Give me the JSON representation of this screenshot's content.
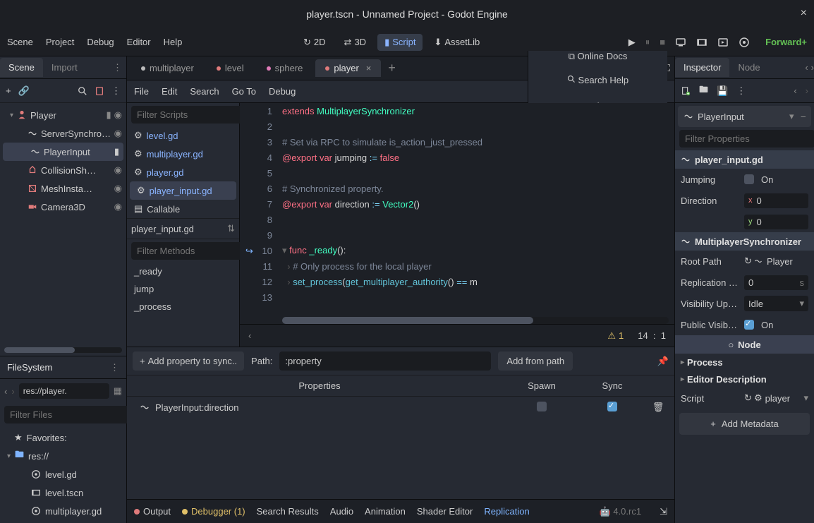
{
  "window": {
    "title": "player.tscn - Unnamed Project - Godot Engine"
  },
  "main_menu": [
    "Scene",
    "Project",
    "Debug",
    "Editor",
    "Help"
  ],
  "workspace_modes": [
    {
      "label": "2D",
      "active": false
    },
    {
      "label": "3D",
      "active": false
    },
    {
      "label": "Script",
      "active": true
    },
    {
      "label": "AssetLib",
      "active": false
    }
  ],
  "renderer": "Forward+",
  "left_tabs": {
    "scene": "Scene",
    "import": "Import"
  },
  "scene_tree": [
    {
      "name": "Player",
      "indent": 0,
      "selected": false,
      "icon": "player",
      "tail": [
        "script",
        "eye"
      ]
    },
    {
      "name": "ServerSynchroniz…",
      "indent": 1,
      "selected": false,
      "icon": "sync",
      "tail": [
        "eye"
      ]
    },
    {
      "name": "PlayerInput",
      "indent": 1,
      "selected": true,
      "icon": "sync",
      "tail": [
        "script"
      ]
    },
    {
      "name": "CollisionSh…",
      "indent": 1,
      "selected": false,
      "icon": "collision",
      "tail": [
        "eye"
      ]
    },
    {
      "name": "MeshInsta…",
      "indent": 1,
      "selected": false,
      "icon": "mesh",
      "tail": [
        "eye"
      ]
    },
    {
      "name": "Camera3D",
      "indent": 1,
      "selected": false,
      "icon": "camera",
      "tail": [
        "eye"
      ]
    }
  ],
  "filesystem": {
    "title": "FileSystem",
    "path": "res://player.",
    "filter_placeholder": "Filter Files",
    "items": [
      {
        "label": "Favorites:",
        "icon": "star",
        "indent": 0,
        "caret": false
      },
      {
        "label": "res://",
        "icon": "folder",
        "indent": 0,
        "caret": true
      },
      {
        "label": "level.gd",
        "icon": "gd",
        "indent": 1,
        "caret": false
      },
      {
        "label": "level.tscn",
        "icon": "scene",
        "indent": 1,
        "caret": false
      },
      {
        "label": "multiplayer.gd",
        "icon": "gd",
        "indent": 1,
        "caret": false
      }
    ]
  },
  "script_tabs": [
    {
      "label": "multiplayer",
      "active": false,
      "color": "#bbbbbb",
      "closable": false
    },
    {
      "label": "level",
      "active": false,
      "color": "#e07b7b",
      "closable": false
    },
    {
      "label": "sphere",
      "active": false,
      "color": "#e07bb8",
      "closable": false
    },
    {
      "label": "player",
      "active": true,
      "color": "#e07b7b",
      "closable": true
    }
  ],
  "script_menu": [
    "File",
    "Edit",
    "Search",
    "Go To",
    "Debug"
  ],
  "script_menu_right": {
    "online": "Online Docs",
    "search": "Search Help"
  },
  "script_filter_placeholder": "Filter Scripts",
  "script_list": [
    {
      "label": "level.gd",
      "selected": false
    },
    {
      "label": "multiplayer.gd",
      "selected": false
    },
    {
      "label": "player.gd",
      "selected": false
    },
    {
      "label": "player_input.gd",
      "selected": true
    },
    {
      "label": "Callable",
      "selected": false,
      "doc": true
    }
  ],
  "current_script": "player_input.gd",
  "method_filter_placeholder": "Filter Methods",
  "methods": [
    "_ready",
    "jump",
    "_process"
  ],
  "code_status": {
    "warnings": "1",
    "line": "14",
    "col": "1"
  },
  "replication": {
    "add_btn": "Add property to sync..",
    "path_label": "Path:",
    "path_value": ":property",
    "add_path": "Add from path",
    "headers": {
      "prop": "Properties",
      "spawn": "Spawn",
      "sync": "Sync"
    },
    "rows": [
      {
        "prop": "PlayerInput:direction",
        "spawn": false,
        "sync": true
      }
    ]
  },
  "bottom_tabs": [
    {
      "label": "Output",
      "dot": "#e07b7b",
      "active": false
    },
    {
      "label": "Debugger (1)",
      "dot": "#e0c068",
      "active": false
    },
    {
      "label": "Search Results",
      "active": false
    },
    {
      "label": "Audio",
      "active": false
    },
    {
      "label": "Animation",
      "active": false
    },
    {
      "label": "Shader Editor",
      "active": false
    },
    {
      "label": "Replication",
      "active": true
    }
  ],
  "version": "4.0.rc1",
  "inspector": {
    "tabs": {
      "inspector": "Inspector",
      "node": "Node"
    },
    "object": "PlayerInput",
    "filter_placeholder": "Filter Properties",
    "script_header": "player_input.gd",
    "props": {
      "jumping": {
        "label": "Jumping",
        "value": "On",
        "checked": false
      },
      "direction": {
        "label": "Direction",
        "x": "0",
        "y": "0"
      }
    },
    "sync_header": "MultiplayerSynchronizer",
    "root_path": {
      "label": "Root Path",
      "value": "Player"
    },
    "rep_interval": {
      "label": "Replication …",
      "value": "0",
      "unit": "s"
    },
    "vis_update": {
      "label": "Visibility Up…",
      "value": "Idle"
    },
    "pub_vis": {
      "label": "Public Visib…",
      "value": "On",
      "checked": true
    },
    "node_cat": "Node",
    "process": "Process",
    "editor_desc": "Editor Description",
    "script_row": {
      "label": "Script",
      "value": "player"
    },
    "add_meta": "Add Metadata"
  }
}
